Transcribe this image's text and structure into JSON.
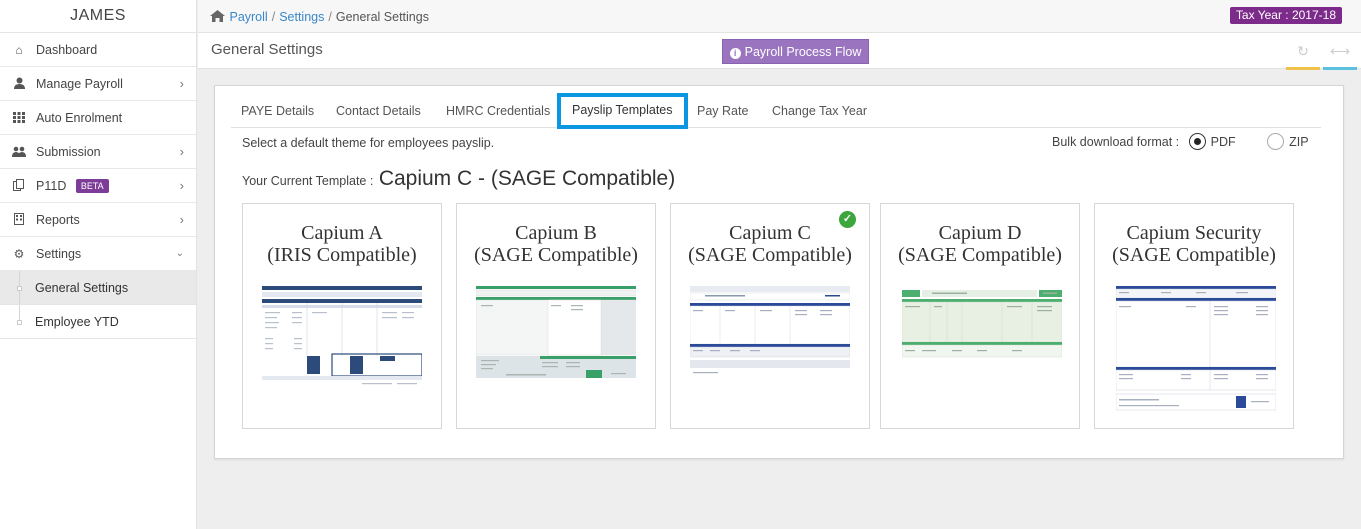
{
  "sidebar": {
    "user_name": "JAMES",
    "items": [
      {
        "label": "Dashboard",
        "icon": "home-icon",
        "has_chevron": false
      },
      {
        "label": "Manage Payroll",
        "icon": "user-icon",
        "has_chevron": true
      },
      {
        "label": "Auto Enrolment",
        "icon": "grid-icon",
        "has_chevron": false
      },
      {
        "label": "Submission",
        "icon": "users-icon",
        "has_chevron": true
      },
      {
        "label": "P11D",
        "icon": "copy-icon",
        "badge": "BETA",
        "has_chevron": true
      },
      {
        "label": "Reports",
        "icon": "building-icon",
        "has_chevron": true
      },
      {
        "label": "Settings",
        "icon": "gear-icon",
        "has_chevron": true
      }
    ],
    "sub_items": [
      {
        "label": "General Settings",
        "active": true
      },
      {
        "label": "Employee YTD",
        "active": false
      }
    ]
  },
  "breadcrumb": {
    "items": [
      "Payroll",
      "Settings",
      "General Settings"
    ]
  },
  "tax_year": "Tax Year : 2017-18",
  "header": {
    "title": "General Settings",
    "flow_button": "Payroll Process Flow"
  },
  "tabs": [
    {
      "label": "PAYE Details",
      "active": false
    },
    {
      "label": "Contact Details",
      "active": false
    },
    {
      "label": "HMRC Credentials",
      "active": false
    },
    {
      "label": "Payslip Templates",
      "active": true
    },
    {
      "label": "Pay Rate",
      "active": false
    },
    {
      "label": "Change Tax Year",
      "active": false
    }
  ],
  "helper_text": "Select a default theme for employees payslip.",
  "bulk": {
    "label": "Bulk download format :",
    "options": [
      {
        "label": "PDF",
        "selected": true
      },
      {
        "label": "ZIP",
        "selected": false
      }
    ]
  },
  "current_template": {
    "label": "Your Current Template :",
    "name": "Capium C - (SAGE Compatible)"
  },
  "templates": [
    {
      "line1": "Capium A",
      "line2": "(IRIS Compatible)",
      "selected": false,
      "accent": "#2c4a7a"
    },
    {
      "line1": "Capium B",
      "line2": "(SAGE Compatible)",
      "selected": false,
      "accent": "#3aa06a"
    },
    {
      "line1": "Capium C",
      "line2": "(SAGE Compatible)",
      "selected": true,
      "accent": "#2c4a9a"
    },
    {
      "line1": "Capium D",
      "line2": "(SAGE Compatible)",
      "selected": false,
      "accent": "#4caf70"
    },
    {
      "line1": "Capium Security",
      "line2": "(SAGE Compatible)",
      "selected": false,
      "accent": "#2c4a9a"
    }
  ],
  "colors": {
    "tab_highlight": "#0a96e0",
    "flow_button": "#9b74c0",
    "tax_year_bg": "#7d2b8b",
    "link": "#3a87c8",
    "selected_check": "#3ca53c"
  }
}
